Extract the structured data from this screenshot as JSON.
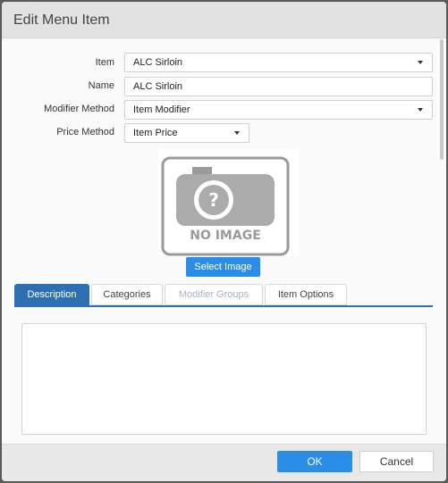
{
  "dialog": {
    "title": "Edit Menu Item"
  },
  "form": {
    "item": {
      "label": "Item",
      "value": "ALC Sirloin"
    },
    "name": {
      "label": "Name",
      "value": "ALC Sirloin"
    },
    "modifier_method": {
      "label": "Modifier Method",
      "value": "Item Modifier"
    },
    "price_method": {
      "label": "Price Method",
      "value": "Item Price"
    }
  },
  "image": {
    "placeholder_text": "NO IMAGE",
    "select_label": "Select Image"
  },
  "tabs": [
    {
      "label": "Description",
      "state": "active"
    },
    {
      "label": "Categories",
      "state": "normal"
    },
    {
      "label": "Modifier Groups",
      "state": "disabled"
    },
    {
      "label": "Item Options",
      "state": "normal"
    }
  ],
  "description": {
    "value": ""
  },
  "footer": {
    "ok_label": "OK",
    "cancel_label": "Cancel"
  },
  "colors": {
    "primary": "#2b8ee6",
    "tab_active": "#2e6fb3",
    "disabled_text": "#a8b2bc"
  }
}
